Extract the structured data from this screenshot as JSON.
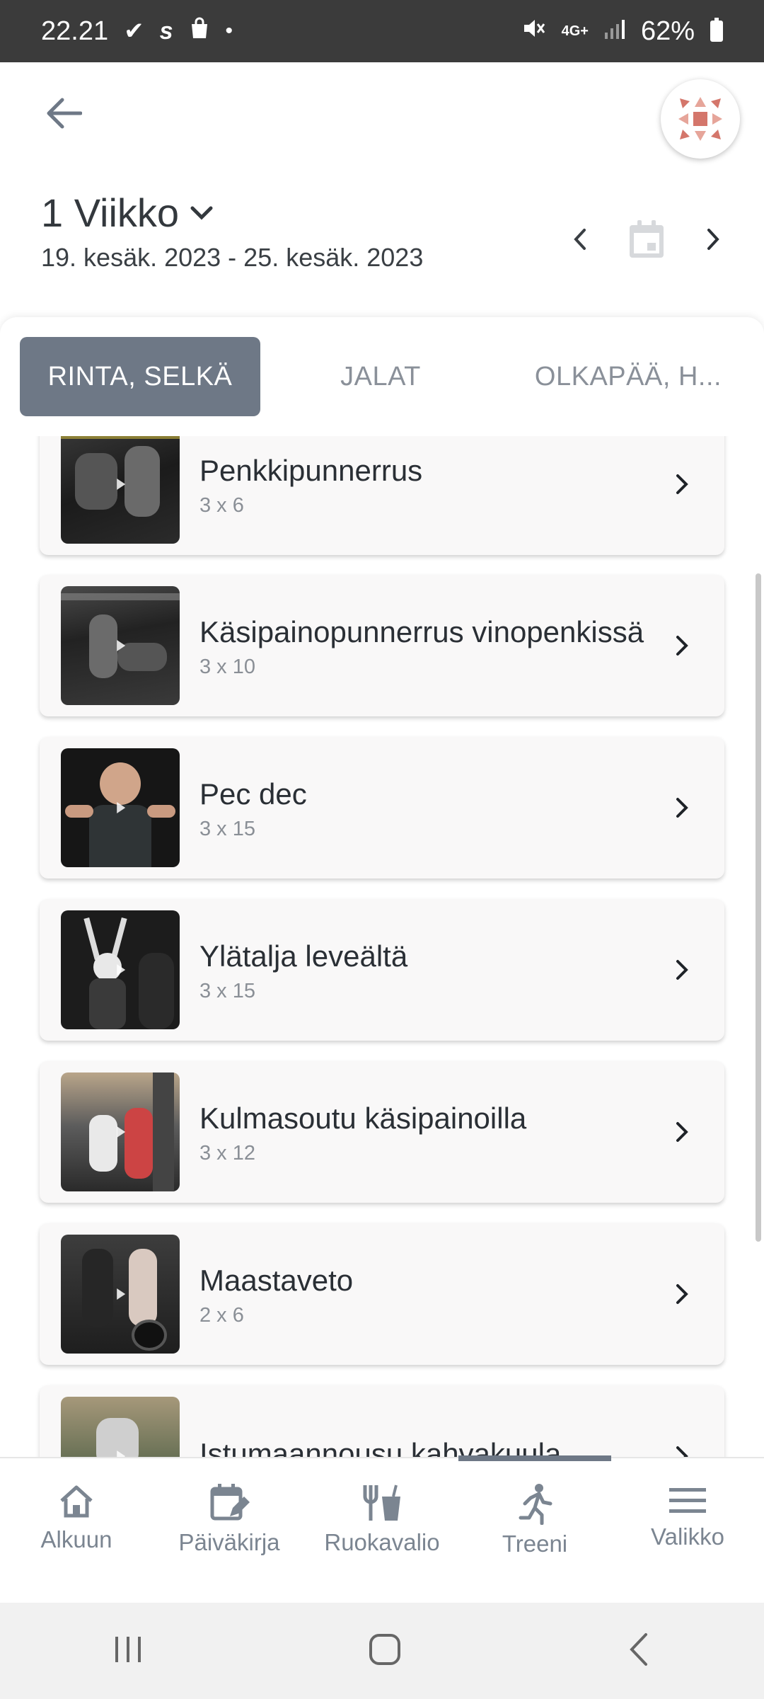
{
  "status": {
    "time": "22.21",
    "network": "4G+",
    "battery": "62%"
  },
  "week": {
    "title": "1 Viikko",
    "range": "19. kesäk. 2023 - 25. kesäk. 2023"
  },
  "tabs": [
    {
      "label": "RINTA, SELKÄ",
      "active": true
    },
    {
      "label": "JALAT",
      "active": false
    },
    {
      "label": "OLKAPÄÄ, H..."
    }
  ],
  "exercises": [
    {
      "name": "Penkkipunnerrus",
      "sets": "3 x 6"
    },
    {
      "name": "Käsipainopunnerrus vinopenkissä",
      "sets": "3 x 10"
    },
    {
      "name": "Pec dec",
      "sets": "3 x 15"
    },
    {
      "name": "Ylätalja leveältä",
      "sets": "3 x 15"
    },
    {
      "name": "Kulmasoutu käsipainoilla",
      "sets": "3 x 12"
    },
    {
      "name": "Maastaveto",
      "sets": "2 x 6"
    },
    {
      "name": "Istumaannousu kahvakuula",
      "sets": ""
    }
  ],
  "bottom_nav": [
    {
      "label": "Alkuun",
      "icon": "home-icon"
    },
    {
      "label": "Päiväkirja",
      "icon": "calendar-edit-icon"
    },
    {
      "label": "Ruokavalio",
      "icon": "food-icon"
    },
    {
      "label": "Treeni",
      "icon": "running-icon",
      "active": true
    },
    {
      "label": "Valikko",
      "icon": "menu-icon"
    }
  ],
  "colors": {
    "accent": "#6e7886",
    "logo": "#d4766b"
  }
}
